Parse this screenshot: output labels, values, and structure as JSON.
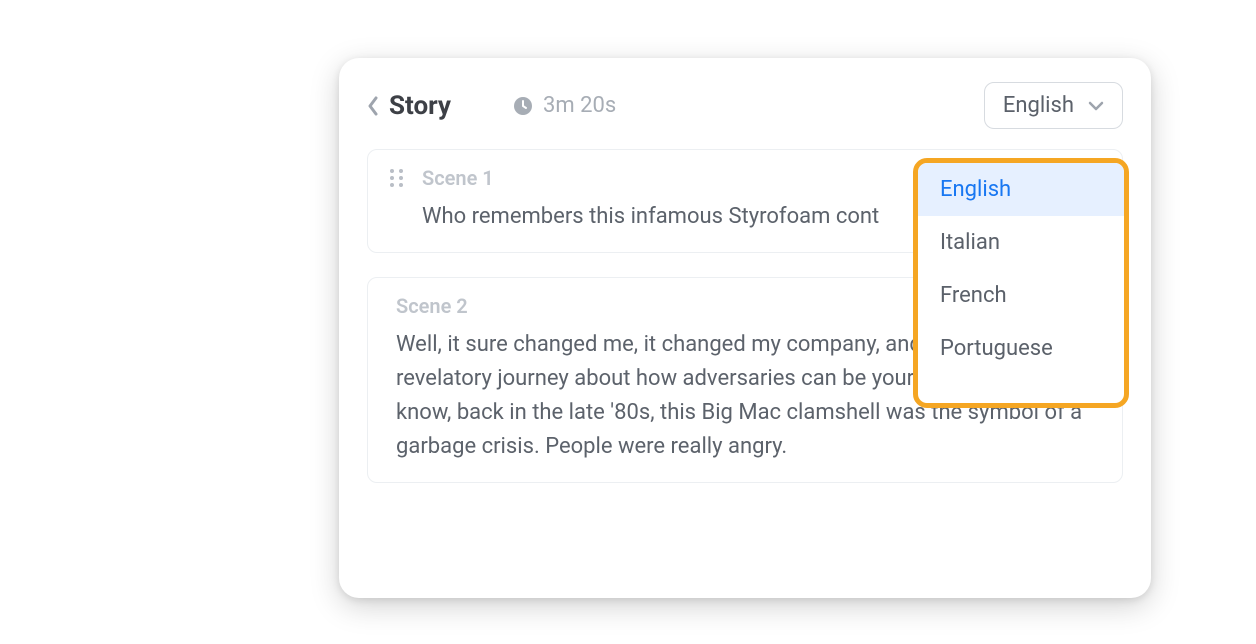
{
  "header": {
    "title": "Story",
    "duration": "3m 20s",
    "language_selected": "English"
  },
  "language_dropdown": {
    "highlight_color": "#f5a623",
    "options": [
      {
        "label": "English",
        "selected": true
      },
      {
        "label": "Italian",
        "selected": false
      },
      {
        "label": "French",
        "selected": false
      },
      {
        "label": "Portuguese",
        "selected": false
      }
    ]
  },
  "scenes": [
    {
      "label": "Scene 1",
      "text": "Who remembers this infamous Styrofoam cont"
    },
    {
      "label": "Scene 2",
      "text": "Well, it sure changed me, it changed my company, and it started a revelatory journey about how adversaries can be your best allies.   You know, back in the late '80s, this Big Mac clamshell was the symbol of a garbage crisis. People were really angry."
    }
  ]
}
